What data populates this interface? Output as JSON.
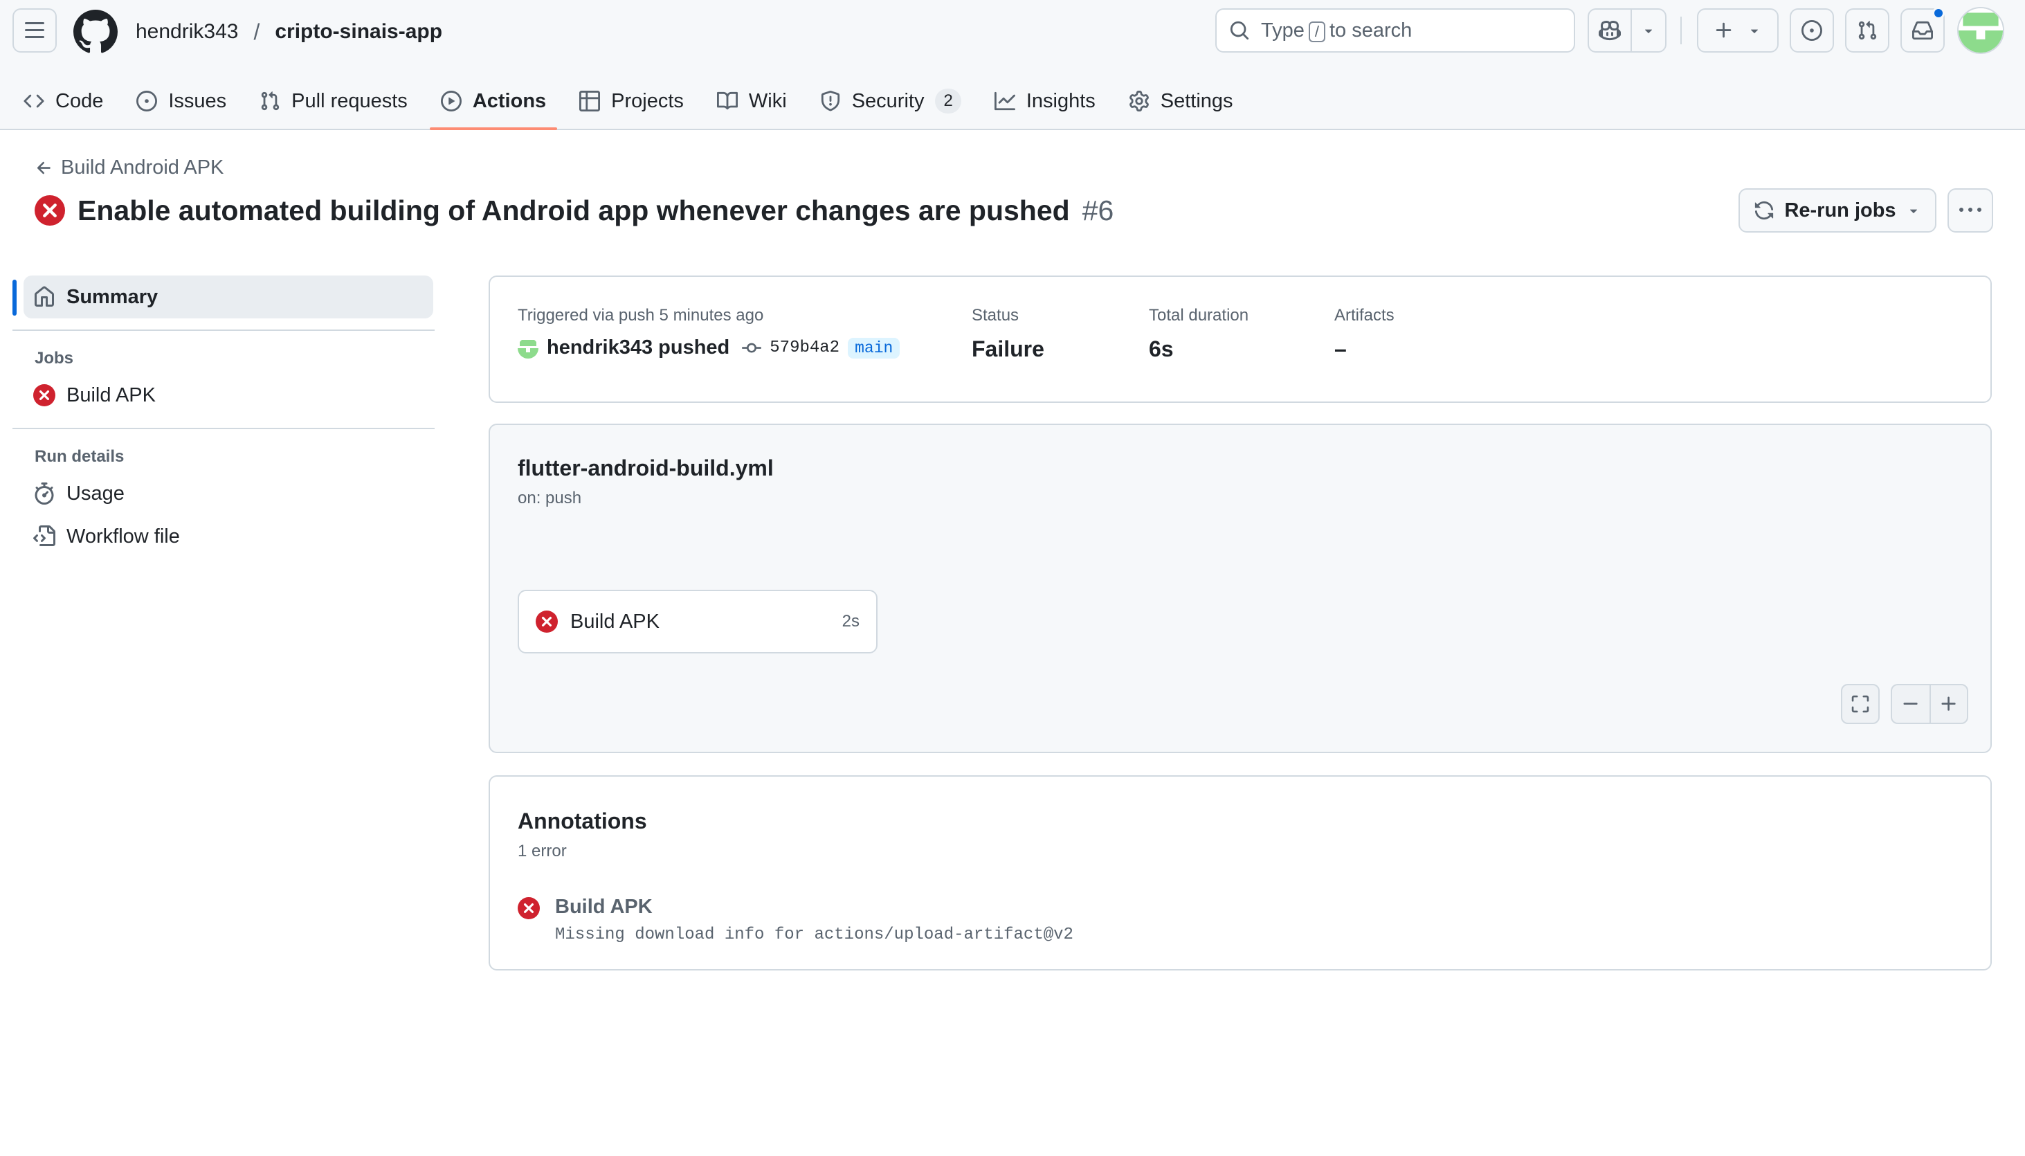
{
  "header": {
    "owner": "hendrik343",
    "separator": "/",
    "repo": "cripto-sinais-app",
    "search": {
      "prefix": "Type",
      "key": "/",
      "suffix": "to search"
    },
    "icons": [
      "hamburger-icon",
      "github-logo",
      "search-icon",
      "copilot-icon",
      "plus-icon",
      "issue-opened-icon",
      "git-pull-request-icon",
      "inbox-icon"
    ]
  },
  "nav": {
    "tabs": [
      {
        "label": "Code",
        "icon": "code-icon"
      },
      {
        "label": "Issues",
        "icon": "issue-opened-icon"
      },
      {
        "label": "Pull requests",
        "icon": "git-pull-request-icon"
      },
      {
        "label": "Actions",
        "icon": "play-icon",
        "selected": true
      },
      {
        "label": "Projects",
        "icon": "table-icon"
      },
      {
        "label": "Wiki",
        "icon": "book-icon"
      },
      {
        "label": "Security",
        "icon": "shield-icon",
        "count": "2"
      },
      {
        "label": "Insights",
        "icon": "graph-icon"
      },
      {
        "label": "Settings",
        "icon": "gear-icon"
      }
    ]
  },
  "run": {
    "workflow_back": "Build Android APK",
    "title": "Enable automated building of Android app whenever changes are pushed",
    "number": "#6",
    "rerun_label": "Re-run jobs"
  },
  "sidebar": {
    "summary_label": "Summary",
    "jobs_heading": "Jobs",
    "jobs": [
      {
        "label": "Build APK",
        "status": "failure"
      }
    ],
    "details_heading": "Run details",
    "details": [
      {
        "label": "Usage",
        "icon": "stopwatch-icon"
      },
      {
        "label": "Workflow file",
        "icon": "file-code-icon"
      }
    ]
  },
  "summary": {
    "trigger_label": "Triggered via push 5 minutes ago",
    "actor": "hendrik343",
    "pushed": "pushed",
    "commit": "579b4a2",
    "branch": "main",
    "status_label": "Status",
    "status_value": "Failure",
    "duration_label": "Total duration",
    "duration_value": "6s",
    "artifacts_label": "Artifacts",
    "artifacts_value": "–"
  },
  "graph": {
    "workflow_file": "flutter-android-build.yml",
    "trigger": "on: push",
    "jobs": [
      {
        "name": "Build APK",
        "duration": "2s",
        "status": "failure"
      }
    ]
  },
  "annotations": {
    "title": "Annotations",
    "count": "1 error",
    "items": [
      {
        "job": "Build APK",
        "message": "Missing download info for actions/upload-artifact@v2"
      }
    ]
  },
  "colors": {
    "failure": "#cf222e",
    "accent": "#0969da",
    "tab_underline": "#fd8c73",
    "avatar_green": "#8ddb8c"
  }
}
